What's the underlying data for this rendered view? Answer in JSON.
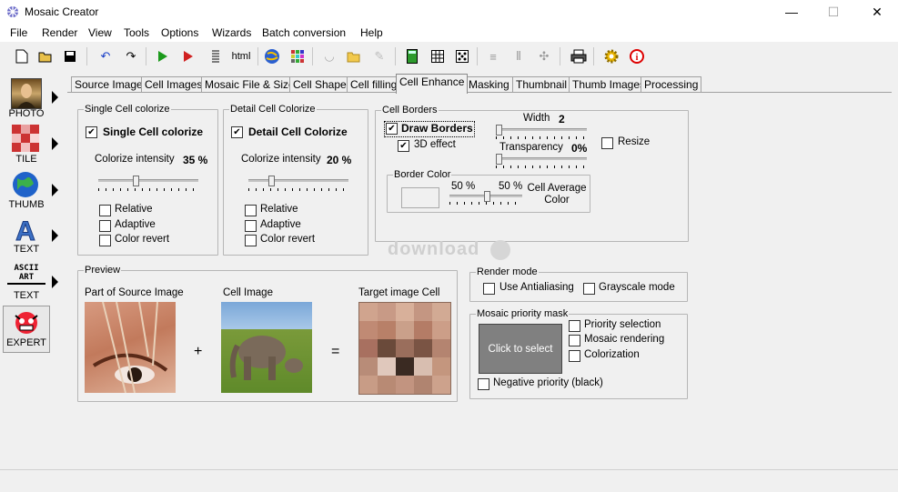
{
  "window": {
    "title": "Mosaic Creator",
    "minimize": "—",
    "maximize": "☐",
    "close": "✕"
  },
  "menu": [
    "File",
    "Render",
    "View",
    "Tools",
    "Options",
    "Wizards",
    "Batch conversion",
    "Help"
  ],
  "toolbar": {
    "html_label": "html"
  },
  "sidebar": {
    "photo": "PHOTO",
    "tile": "TILE",
    "thumb": "THUMB",
    "text": "TEXT",
    "ascii_line1": "ASCII",
    "ascii_line2": "ART",
    "ascii_text": "TEXT",
    "expert": "EXPERT"
  },
  "tabs": [
    "Source Image",
    "Cell Images",
    "Mosaic File & Size",
    "Cell Shape",
    "Cell filling",
    "Cell Enhance",
    "Masking",
    "Thumbnail",
    "Thumb Images",
    "Processing"
  ],
  "active_tab": "Cell Enhance",
  "single": {
    "group": "Single Cell colorize",
    "check_label": "Single Cell colorize",
    "checked": "✔",
    "intensity_label": "Colorize intensity",
    "intensity_value": "35 %",
    "relative": "Relative",
    "adaptive": "Adaptive",
    "color_revert": "Color revert"
  },
  "detail": {
    "group": "Detail Cell Colorize",
    "check_label": "Detail Cell Colorize",
    "checked": "✔",
    "intensity_label": "Colorize intensity",
    "intensity_value": "20 %",
    "relative": "Relative",
    "adaptive": "Adaptive",
    "color_revert": "Color revert"
  },
  "borders": {
    "group": "Cell Borders",
    "draw_label": "Draw Borders",
    "draw_checked": "✔",
    "effect_label": "3D effect",
    "effect_checked": "✔",
    "width_label": "Width",
    "width_value": "2",
    "transparency_label": "Transparency",
    "transparency_value": "0%",
    "resize": "Resize",
    "border_color_group": "Border Color",
    "pct1": "50 %",
    "pct2": "50 %",
    "avg_line1": "Cell Average",
    "avg_line2": "Color"
  },
  "watermark": "download",
  "preview": {
    "group": "Preview",
    "source_label": "Part of Source Image",
    "cell_label": "Cell Image",
    "target_label": "Target image Cell",
    "plus": "+",
    "equals": "="
  },
  "render_mode": {
    "group": "Render mode",
    "antialias": "Use Antialiasing",
    "grayscale": "Grayscale mode"
  },
  "priority": {
    "group": "Mosaic priority mask",
    "click": "Click to select",
    "selection": "Priority selection",
    "rendering": "Mosaic rendering",
    "colorization": "Colorization",
    "negative": "Negative priority (black)"
  }
}
